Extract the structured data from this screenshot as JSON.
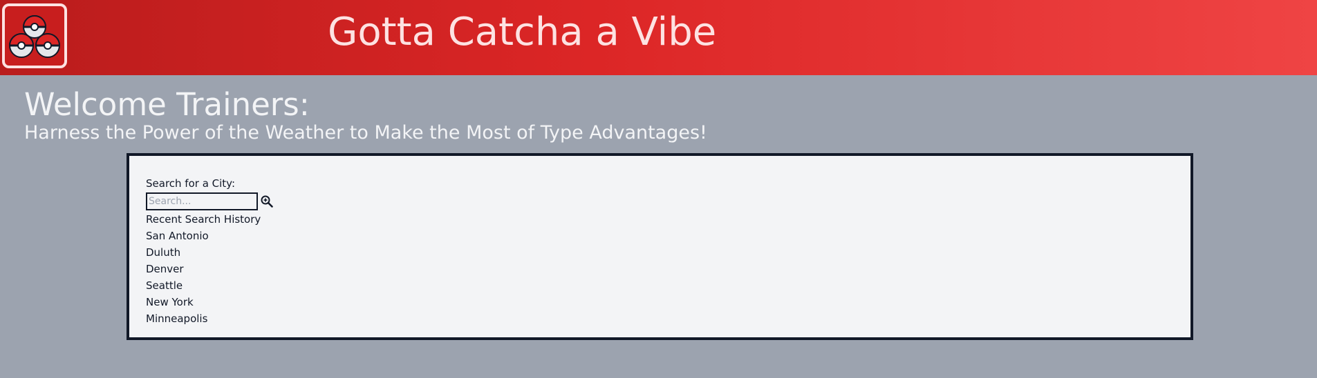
{
  "header": {
    "title": "Gotta Catcha a Vibe",
    "logo_icon": "pokeball-trio-icon",
    "colors": {
      "gradient_start": "#b91c1c",
      "gradient_end": "#ef4444",
      "title_text": "#fde2e2"
    }
  },
  "intro": {
    "welcome": "Welcome Trainers:",
    "subtitle": "Harness the Power of the Weather to Make the Most of Type Advantages!"
  },
  "search": {
    "label": "Search for a City:",
    "placeholder": "Search...",
    "value": "",
    "button_icon": "search-zoom-icon"
  },
  "history": {
    "title": "Recent Search History",
    "items": [
      "San Antonio",
      "Duluth",
      "Denver",
      "Seattle",
      "New York",
      "Minneapolis"
    ]
  },
  "colors": {
    "page_bg": "#9ca3af",
    "panel_bg": "#f3f4f6",
    "panel_border": "#111827"
  }
}
